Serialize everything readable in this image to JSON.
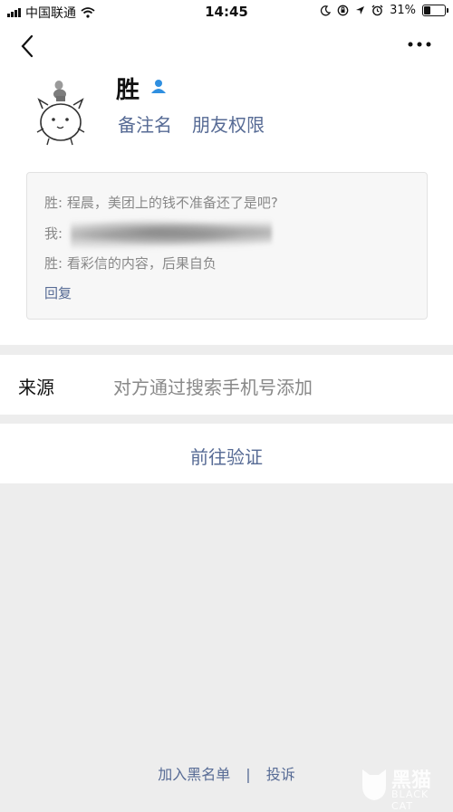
{
  "status_bar": {
    "carrier": "中国联通",
    "time": "14:45",
    "battery": "31%",
    "icons": [
      "signal-icon",
      "wifi-icon",
      "moon-icon",
      "orientation-lock-icon",
      "location-icon",
      "alarm-icon",
      "battery-icon"
    ]
  },
  "nav": {
    "back_icon": "chevron-left-icon",
    "more_icon": "more-dots-icon"
  },
  "profile": {
    "name": "胜",
    "badge_icon": "person-verify-icon",
    "actions": [
      "备注名",
      "朋友权限"
    ]
  },
  "messages": {
    "lines": [
      "胜: 程晨，美团上的钱不准备还了是吧?",
      "我:",
      "胜: 看彩信的内容，后果自负"
    ],
    "reply": "回复"
  },
  "source": {
    "label": "来源",
    "value": "对方通过搜索手机号添加"
  },
  "action": {
    "label": "前往验证"
  },
  "footer": {
    "blacklist": "加入黑名单",
    "separator": "|",
    "report": "投诉"
  },
  "watermark": {
    "cn": "黑猫",
    "en": "BLACK CAT"
  },
  "colors": {
    "link": "#576b95",
    "gray_text": "#888888",
    "background": "#ededed"
  }
}
